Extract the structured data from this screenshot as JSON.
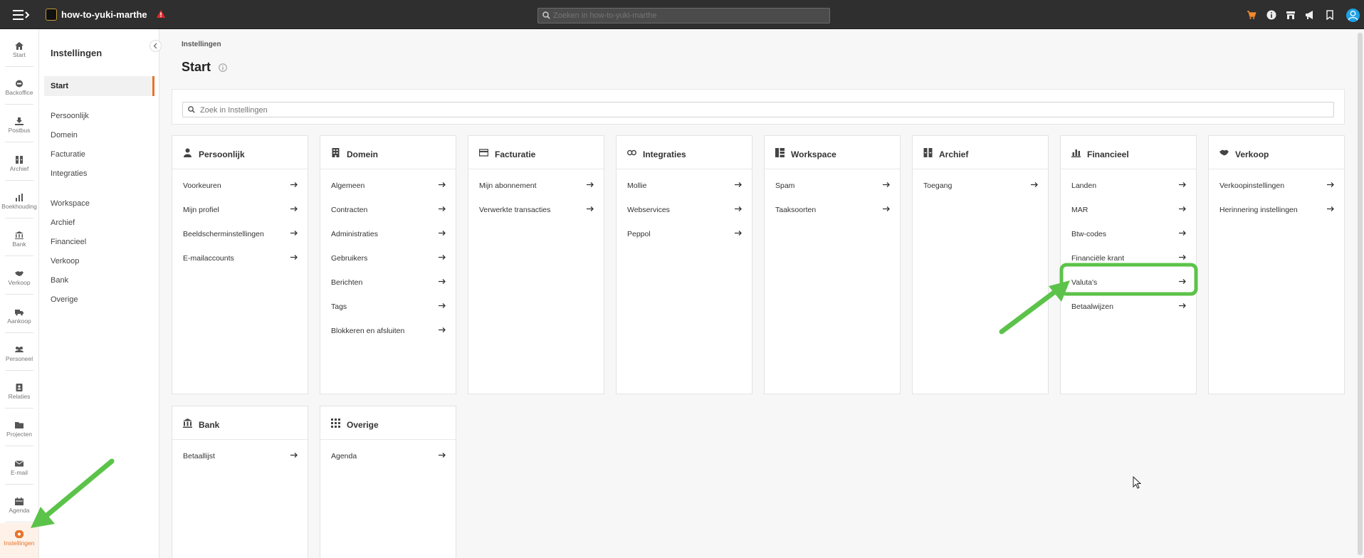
{
  "app": {
    "title": "how-to-yuki-marthe"
  },
  "topbar": {
    "search_placeholder": "Zoeken in how-to-yuki-marthe"
  },
  "rail": {
    "items": [
      {
        "label": "Start",
        "icon": "home-icon"
      },
      {
        "label": "Backoffice",
        "icon": "backoffice-icon"
      },
      {
        "label": "Postbus",
        "icon": "inbox-icon"
      },
      {
        "label": "Archief",
        "icon": "archive-icon"
      },
      {
        "label": "Boekhouding",
        "icon": "bar-chart-icon"
      },
      {
        "label": "Bank",
        "icon": "bank-icon"
      },
      {
        "label": "Verkoop",
        "icon": "handshake-icon"
      },
      {
        "label": "Aankoop",
        "icon": "truck-icon"
      },
      {
        "label": "Personeel",
        "icon": "people-icon"
      },
      {
        "label": "Relaties",
        "icon": "contacts-icon"
      },
      {
        "label": "Projecten",
        "icon": "folder-icon"
      },
      {
        "label": "E-mail",
        "icon": "envelope-icon"
      },
      {
        "label": "Agenda",
        "icon": "calendar-icon"
      },
      {
        "label": "Instellingen",
        "icon": "settings-icon"
      }
    ]
  },
  "sidenav": {
    "title": "Instellingen",
    "active": "Start",
    "group1": [
      "Persoonlijk",
      "Domein",
      "Facturatie",
      "Integraties"
    ],
    "group2": [
      "Workspace",
      "Archief",
      "Financieel",
      "Verkoop",
      "Bank",
      "Overige"
    ]
  },
  "main": {
    "breadcrumb": "Instellingen",
    "title": "Start",
    "search_placeholder": "Zoek in Instellingen",
    "cards": [
      {
        "title": "Persoonlijk",
        "icon": "person-icon",
        "items": [
          "Voorkeuren",
          "Mijn profiel",
          "Beeldscherminstellingen",
          "E-mailaccounts"
        ]
      },
      {
        "title": "Domein",
        "icon": "building-icon",
        "items": [
          "Algemeen",
          "Contracten",
          "Administraties",
          "Gebruikers",
          "Berichten",
          "Tags",
          "Blokkeren en afsluiten"
        ]
      },
      {
        "title": "Facturatie",
        "icon": "invoice-icon",
        "items": [
          "Mijn abonnement",
          "Verwerkte transacties"
        ]
      },
      {
        "title": "Integraties",
        "icon": "link-icon",
        "items": [
          "Mollie",
          "Webservices",
          "Peppol"
        ]
      },
      {
        "title": "Workspace",
        "icon": "workspace-icon",
        "items": [
          "Spam",
          "Taaksoorten"
        ]
      },
      {
        "title": "Archief",
        "icon": "archive-icon",
        "items": [
          "Toegang"
        ]
      },
      {
        "title": "Financieel",
        "icon": "bar-chart-icon",
        "items": [
          "Landen",
          "MAR",
          "Btw-codes",
          "Financiële krant",
          "Valuta's",
          "Betaalwijzen"
        ]
      },
      {
        "title": "Verkoop",
        "icon": "handshake-icon",
        "items": [
          "Verkoopinstellingen",
          "Herinnering instellingen"
        ]
      },
      {
        "title": "Bank",
        "icon": "bank-icon",
        "items": [
          "Betaallijst"
        ]
      },
      {
        "title": "Overige",
        "icon": "grid-icon",
        "items": [
          "Agenda"
        ]
      }
    ]
  },
  "annotations": {
    "highlight": "Valuta's",
    "color": "#5cc34a"
  },
  "colors": {
    "accent": "#e8742b",
    "topbar": "#2f2f2f"
  }
}
